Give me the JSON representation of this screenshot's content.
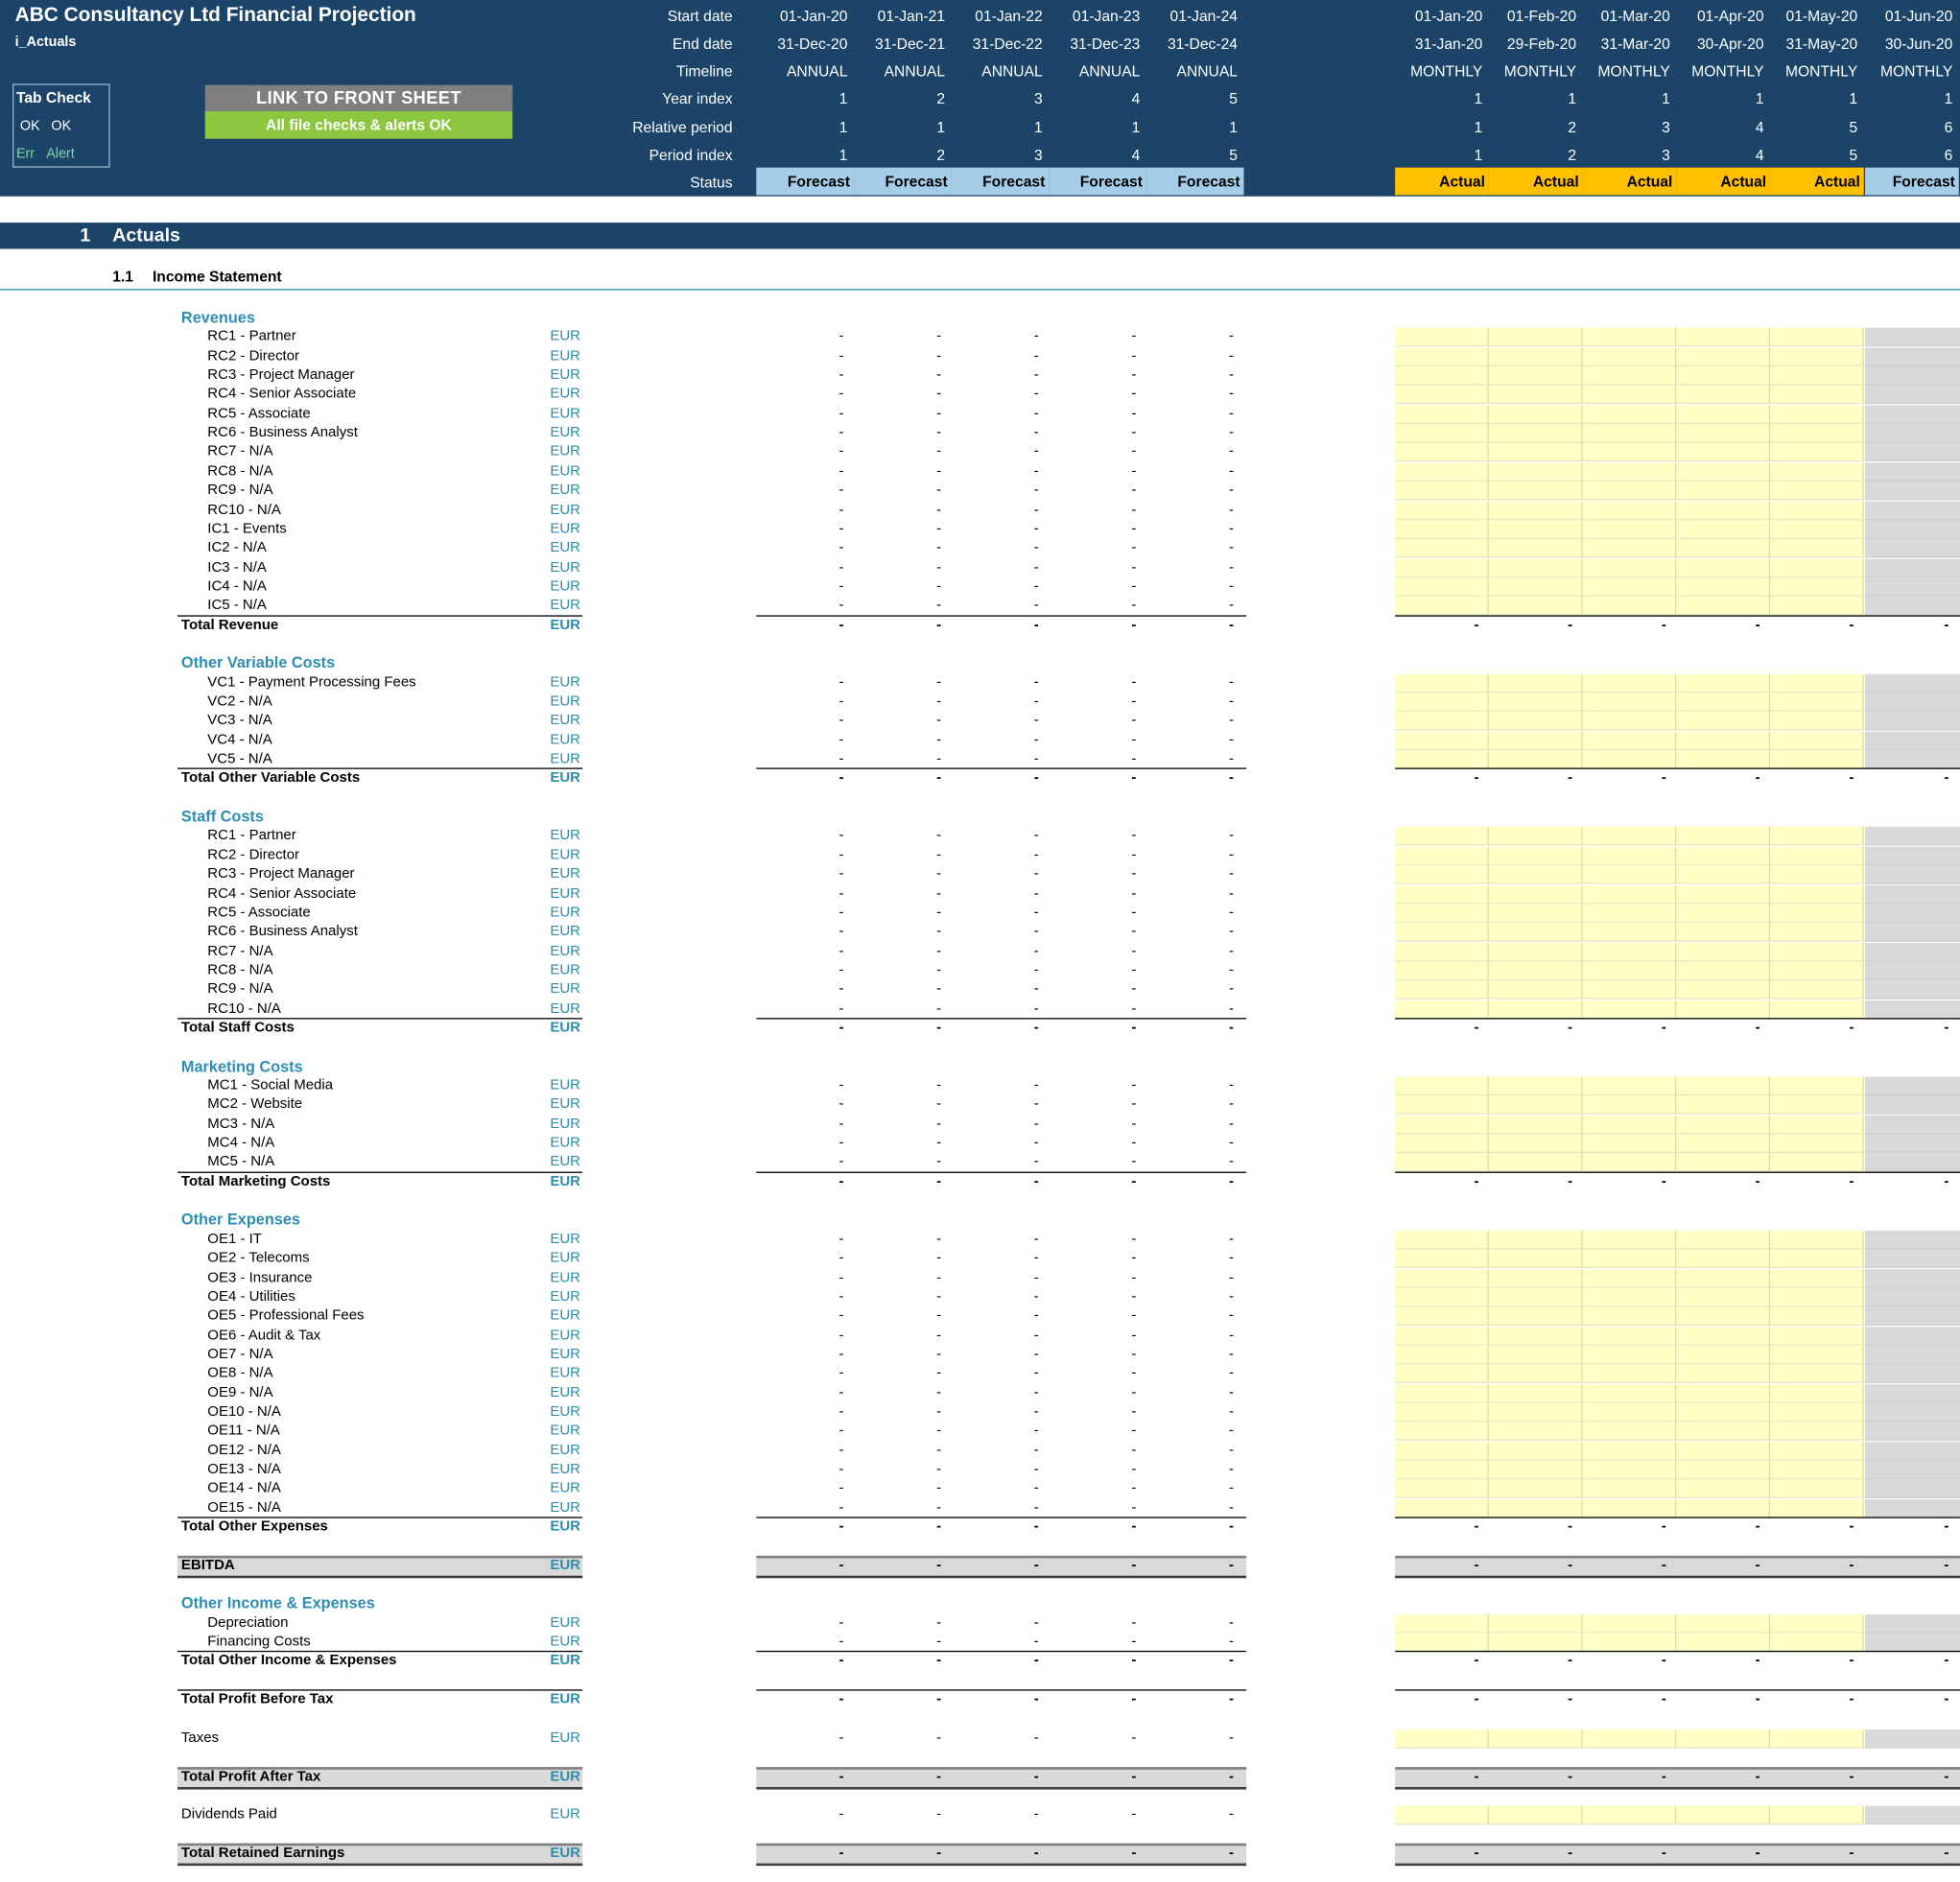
{
  "title": "ABC Consultancy Ltd Financial Projection",
  "sheet": "i_Actuals",
  "tab_check": {
    "title": "Tab Check",
    "ok1": "OK",
    "ok2": "OK",
    "err": "Err",
    "alert": "Alert"
  },
  "buttons": {
    "front": "LINK TO FRONT SHEET",
    "checks": "All file checks & alerts OK"
  },
  "header_labels": [
    "Start date",
    "End date",
    "Timeline",
    "Year index",
    "Relative period",
    "Period index",
    "Status"
  ],
  "annual": [
    {
      "start": "01-Jan-20",
      "end": "31-Dec-20",
      "timeline": "ANNUAL",
      "year": "1",
      "rel": "1",
      "period": "1",
      "status": "Forecast"
    },
    {
      "start": "01-Jan-21",
      "end": "31-Dec-21",
      "timeline": "ANNUAL",
      "year": "2",
      "rel": "1",
      "period": "2",
      "status": "Forecast"
    },
    {
      "start": "01-Jan-22",
      "end": "31-Dec-22",
      "timeline": "ANNUAL",
      "year": "3",
      "rel": "1",
      "period": "3",
      "status": "Forecast"
    },
    {
      "start": "01-Jan-23",
      "end": "31-Dec-23",
      "timeline": "ANNUAL",
      "year": "4",
      "rel": "1",
      "period": "4",
      "status": "Forecast"
    },
    {
      "start": "01-Jan-24",
      "end": "31-Dec-24",
      "timeline": "ANNUAL",
      "year": "5",
      "rel": "1",
      "period": "5",
      "status": "Forecast"
    }
  ],
  "monthly": [
    {
      "start": "01-Jan-20",
      "end": "31-Jan-20",
      "timeline": "MONTHLY",
      "year": "1",
      "rel": "1",
      "period": "1",
      "status": "Actual"
    },
    {
      "start": "01-Feb-20",
      "end": "29-Feb-20",
      "timeline": "MONTHLY",
      "year": "1",
      "rel": "2",
      "period": "2",
      "status": "Actual"
    },
    {
      "start": "01-Mar-20",
      "end": "31-Mar-20",
      "timeline": "MONTHLY",
      "year": "1",
      "rel": "3",
      "period": "3",
      "status": "Actual"
    },
    {
      "start": "01-Apr-20",
      "end": "30-Apr-20",
      "timeline": "MONTHLY",
      "year": "1",
      "rel": "4",
      "period": "4",
      "status": "Actual"
    },
    {
      "start": "01-May-20",
      "end": "31-May-20",
      "timeline": "MONTHLY",
      "year": "1",
      "rel": "5",
      "period": "5",
      "status": "Actual"
    },
    {
      "start": "01-Jun-20",
      "end": "30-Jun-20",
      "timeline": "MONTHLY",
      "year": "1",
      "rel": "6",
      "period": "6",
      "status": "Forecast"
    }
  ],
  "colors": {
    "navy": "#1b4468",
    "forecast": "#a6cde8",
    "actual": "#ffc000",
    "input": "#ffffc6",
    "locked": "#d9d9d9",
    "accent": "#2e8db3"
  },
  "section": {
    "num": "1",
    "title": "Actuals"
  },
  "subsection": {
    "num": "1.1",
    "title": "Income Statement"
  },
  "dash": "-",
  "rows": [
    {
      "t": "hd",
      "label": "Revenues"
    },
    {
      "t": "in",
      "label": "RC1 - Partner",
      "unit": "EUR"
    },
    {
      "t": "in",
      "label": "RC2 - Director",
      "unit": "EUR"
    },
    {
      "t": "in",
      "label": "RC3 - Project Manager",
      "unit": "EUR"
    },
    {
      "t": "in",
      "label": "RC4 - Senior Associate",
      "unit": "EUR"
    },
    {
      "t": "in",
      "label": "RC5 - Associate",
      "unit": "EUR"
    },
    {
      "t": "in",
      "label": "RC6 - Business Analyst",
      "unit": "EUR"
    },
    {
      "t": "in",
      "label": "RC7 - N/A",
      "unit": "EUR"
    },
    {
      "t": "in",
      "label": "RC8 - N/A",
      "unit": "EUR"
    },
    {
      "t": "in",
      "label": "RC9 - N/A",
      "unit": "EUR"
    },
    {
      "t": "in",
      "label": "RC10 - N/A",
      "unit": "EUR"
    },
    {
      "t": "in",
      "label": "IC1 - Events",
      "unit": "EUR"
    },
    {
      "t": "in",
      "label": "IC2 - N/A",
      "unit": "EUR"
    },
    {
      "t": "in",
      "label": "IC3 - N/A",
      "unit": "EUR"
    },
    {
      "t": "in",
      "label": "IC4 - N/A",
      "unit": "EUR"
    },
    {
      "t": "in",
      "label": "IC5 - N/A",
      "unit": "EUR"
    },
    {
      "t": "tot",
      "label": "Total Revenue",
      "unit": "EUR"
    },
    {
      "t": "blank"
    },
    {
      "t": "hd",
      "label": "Other Variable Costs"
    },
    {
      "t": "in",
      "label": "VC1 - Payment Processing Fees",
      "unit": "EUR"
    },
    {
      "t": "in",
      "label": "VC2 - N/A",
      "unit": "EUR"
    },
    {
      "t": "in",
      "label": "VC3 - N/A",
      "unit": "EUR"
    },
    {
      "t": "in",
      "label": "VC4 - N/A",
      "unit": "EUR"
    },
    {
      "t": "in",
      "label": "VC5 - N/A",
      "unit": "EUR"
    },
    {
      "t": "tot",
      "label": "Total Other Variable Costs",
      "unit": "EUR"
    },
    {
      "t": "blank"
    },
    {
      "t": "hd",
      "label": "Staff Costs"
    },
    {
      "t": "in",
      "label": "RC1 - Partner",
      "unit": "EUR"
    },
    {
      "t": "in",
      "label": "RC2 - Director",
      "unit": "EUR"
    },
    {
      "t": "in",
      "label": "RC3 - Project Manager",
      "unit": "EUR"
    },
    {
      "t": "in",
      "label": "RC4 - Senior Associate",
      "unit": "EUR"
    },
    {
      "t": "in",
      "label": "RC5 - Associate",
      "unit": "EUR"
    },
    {
      "t": "in",
      "label": "RC6 - Business Analyst",
      "unit": "EUR"
    },
    {
      "t": "in",
      "label": "RC7 - N/A",
      "unit": "EUR"
    },
    {
      "t": "in",
      "label": "RC8 - N/A",
      "unit": "EUR"
    },
    {
      "t": "in",
      "label": "RC9 - N/A",
      "unit": "EUR"
    },
    {
      "t": "in",
      "label": "RC10 - N/A",
      "unit": "EUR"
    },
    {
      "t": "tot",
      "label": "Total Staff Costs",
      "unit": "EUR"
    },
    {
      "t": "blank"
    },
    {
      "t": "hd",
      "label": "Marketing Costs"
    },
    {
      "t": "in",
      "label": "MC1 - Social Media",
      "unit": "EUR"
    },
    {
      "t": "in",
      "label": "MC2 - Website",
      "unit": "EUR"
    },
    {
      "t": "in",
      "label": "MC3 - N/A",
      "unit": "EUR"
    },
    {
      "t": "in",
      "label": "MC4 - N/A",
      "unit": "EUR"
    },
    {
      "t": "in",
      "label": "MC5 - N/A",
      "unit": "EUR"
    },
    {
      "t": "tot",
      "label": "Total Marketing Costs",
      "unit": "EUR"
    },
    {
      "t": "blank"
    },
    {
      "t": "hd",
      "label": "Other Expenses"
    },
    {
      "t": "in",
      "label": "OE1 - IT",
      "unit": "EUR"
    },
    {
      "t": "in",
      "label": "OE2 - Telecoms",
      "unit": "EUR"
    },
    {
      "t": "in",
      "label": "OE3 - Insurance",
      "unit": "EUR"
    },
    {
      "t": "in",
      "label": "OE4 - Utilities",
      "unit": "EUR"
    },
    {
      "t": "in",
      "label": "OE5 - Professional Fees",
      "unit": "EUR"
    },
    {
      "t": "in",
      "label": "OE6 - Audit & Tax",
      "unit": "EUR"
    },
    {
      "t": "in",
      "label": "OE7 - N/A",
      "unit": "EUR"
    },
    {
      "t": "in",
      "label": "OE8 - N/A",
      "unit": "EUR"
    },
    {
      "t": "in",
      "label": "OE9 - N/A",
      "unit": "EUR"
    },
    {
      "t": "in",
      "label": "OE10 - N/A",
      "unit": "EUR"
    },
    {
      "t": "in",
      "label": "OE11 - N/A",
      "unit": "EUR"
    },
    {
      "t": "in",
      "label": "OE12 - N/A",
      "unit": "EUR"
    },
    {
      "t": "in",
      "label": "OE13 - N/A",
      "unit": "EUR"
    },
    {
      "t": "in",
      "label": "OE14 - N/A",
      "unit": "EUR"
    },
    {
      "t": "in",
      "label": "OE15 - N/A",
      "unit": "EUR"
    },
    {
      "t": "tot",
      "label": "Total Other Expenses",
      "unit": "EUR"
    },
    {
      "t": "blank"
    },
    {
      "t": "gtot",
      "label": "EBITDA",
      "unit": "EUR"
    },
    {
      "t": "blank"
    },
    {
      "t": "hd",
      "label": "Other Income & Expenses"
    },
    {
      "t": "in",
      "label": "Depreciation",
      "unit": "EUR"
    },
    {
      "t": "in",
      "label": "Financing Costs",
      "unit": "EUR"
    },
    {
      "t": "tot",
      "label": "Total Other Income & Expenses",
      "unit": "EUR"
    },
    {
      "t": "blank"
    },
    {
      "t": "tot",
      "label": "Total Profit Before Tax",
      "unit": "EUR"
    },
    {
      "t": "blank"
    },
    {
      "t": "in1",
      "label": "Taxes",
      "unit": "EUR"
    },
    {
      "t": "blank"
    },
    {
      "t": "gtot",
      "label": "Total Profit After Tax",
      "unit": "EUR"
    },
    {
      "t": "blank"
    },
    {
      "t": "in1",
      "label": "Dividends Paid",
      "unit": "EUR"
    },
    {
      "t": "blank"
    },
    {
      "t": "gtot",
      "label": "Total Retained Earnings",
      "unit": "EUR"
    }
  ]
}
